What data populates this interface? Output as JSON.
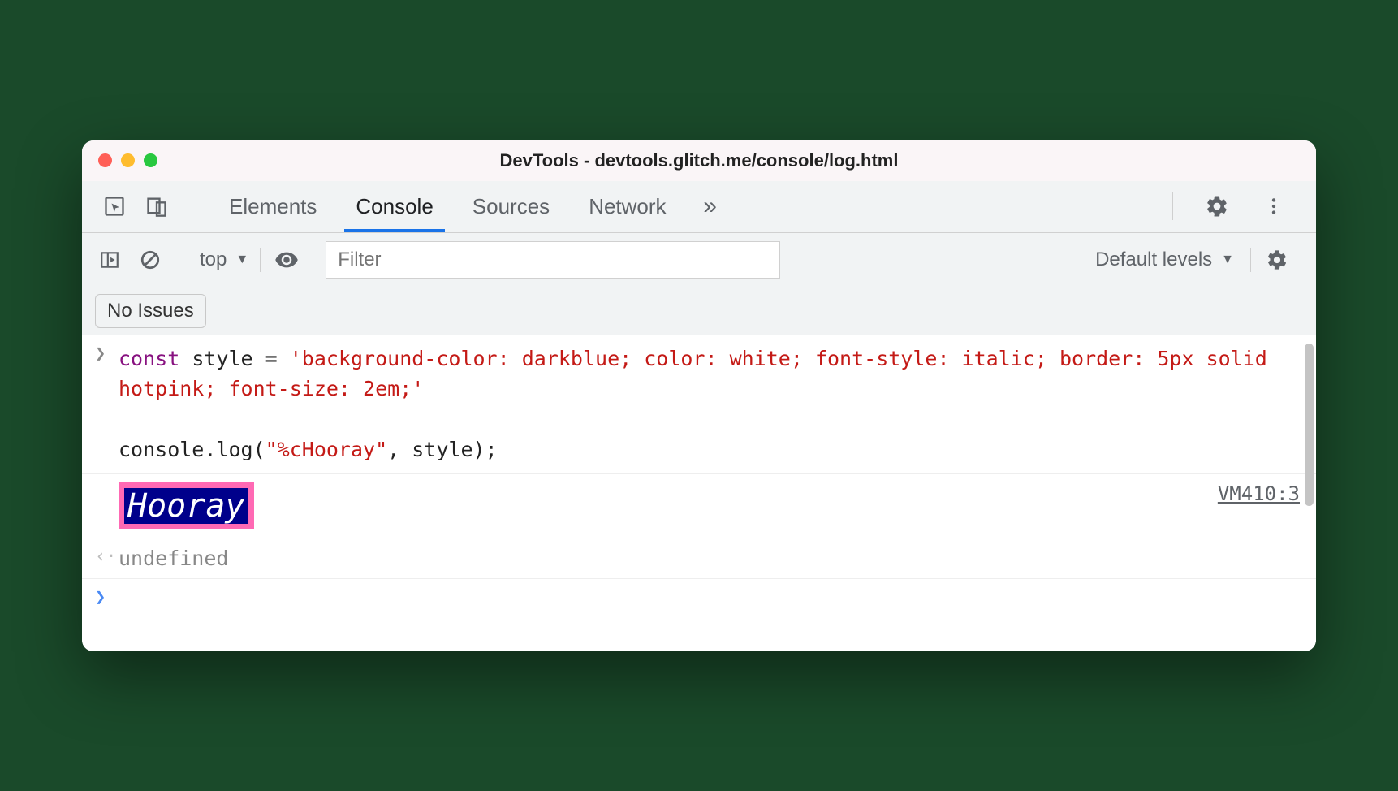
{
  "window": {
    "title": "DevTools - devtools.glitch.me/console/log.html"
  },
  "tabs": {
    "elements": "Elements",
    "console": "Console",
    "sources": "Sources",
    "network": "Network"
  },
  "toolbar": {
    "context": "top",
    "filter_placeholder": "Filter",
    "levels": "Default levels"
  },
  "issues": {
    "label": "No Issues"
  },
  "console": {
    "input_code_html": "<span class=\"kw\">const</span> style = <span class=\"str\">'background-color: darkblue; color: white; font-style: italic; border: 5px solid hotpink; font-size: 2em;'</span>\n\nconsole.log(<span class=\"str\">\"%cHooray\"</span>, style);",
    "styled_output": "Hooray",
    "source_link": "VM410:3",
    "return_value": "undefined"
  }
}
